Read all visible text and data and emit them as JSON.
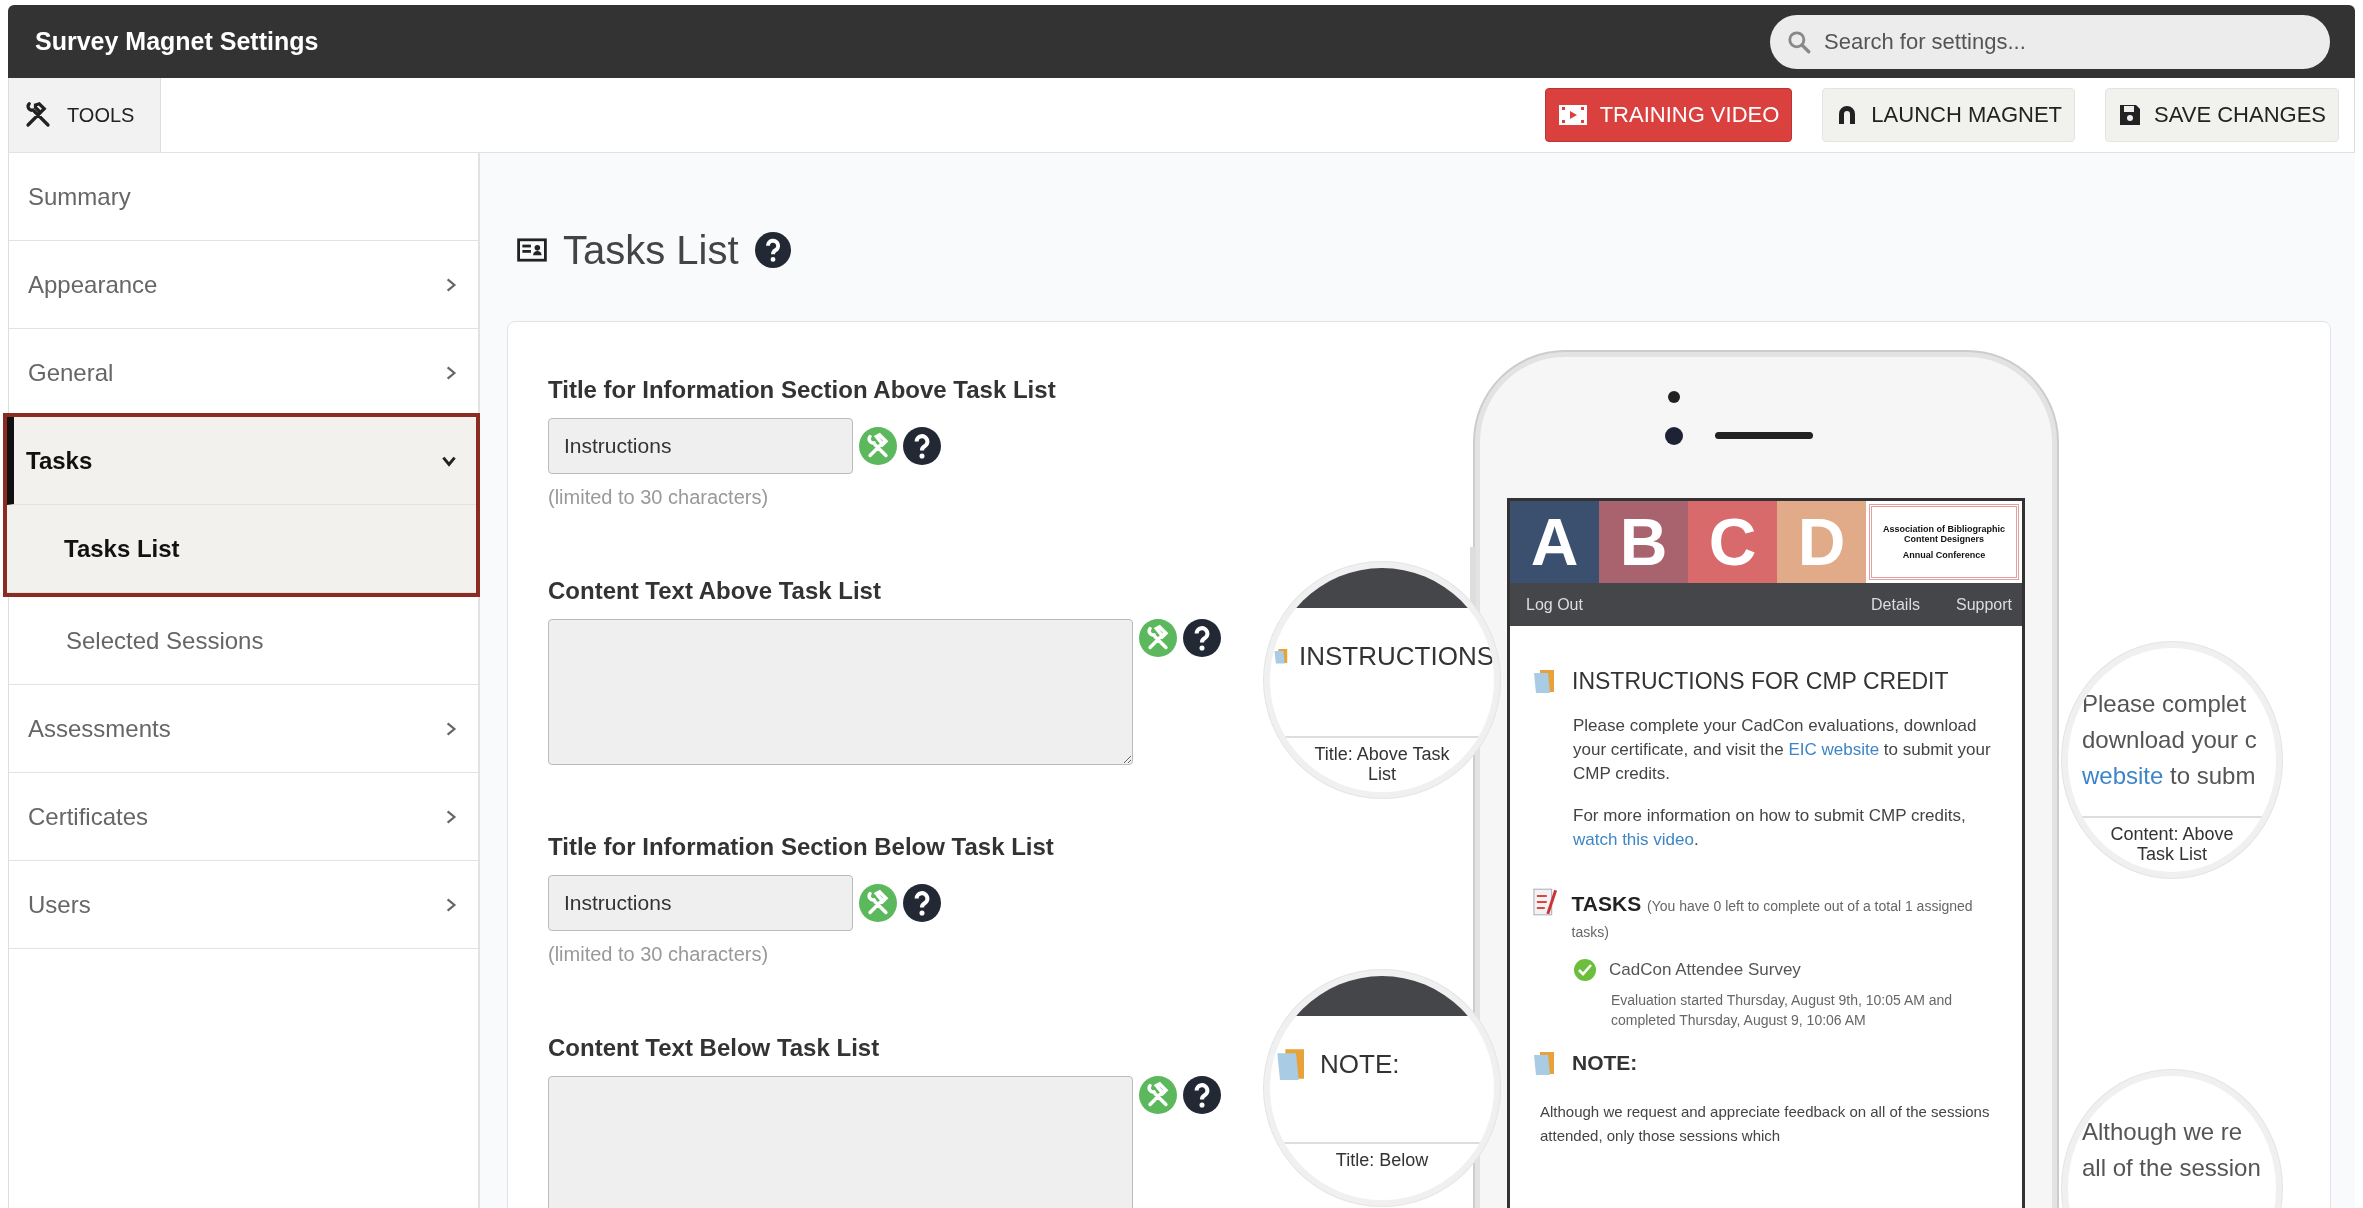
{
  "window": {
    "title": "Survey Magnet Settings"
  },
  "search": {
    "placeholder": "Search for settings..."
  },
  "toolbar": {
    "tools_tab": "TOOLS",
    "buttons": [
      {
        "label": "TRAINING VIDEO",
        "kind": "video"
      },
      {
        "label": "LAUNCH MAGNET",
        "kind": "magnet"
      },
      {
        "label": "SAVE CHANGES",
        "kind": "save"
      }
    ]
  },
  "sidebar": {
    "items": [
      {
        "label": "Summary",
        "kind": "link",
        "selected": false
      },
      {
        "label": "Appearance",
        "kind": "group",
        "selected": false,
        "expanded": false
      },
      {
        "label": "General",
        "kind": "group",
        "selected": false,
        "expanded": false
      },
      {
        "label": "Tasks",
        "kind": "group",
        "selected": true,
        "expanded": true,
        "highlighted": true,
        "children": [
          {
            "label": "Tasks List",
            "selected": true,
            "highlighted": true
          },
          {
            "label": "Selected Sessions",
            "selected": false,
            "highlighted": false
          }
        ]
      },
      {
        "label": "Assessments",
        "kind": "group",
        "selected": false,
        "expanded": false
      },
      {
        "label": "Certificates",
        "kind": "group",
        "selected": false,
        "expanded": false
      },
      {
        "label": "Users",
        "kind": "group",
        "selected": false,
        "expanded": false
      }
    ]
  },
  "page": {
    "title": "Tasks List"
  },
  "fields": [
    {
      "kind": "input",
      "label": "Title for Information Section Above Task List",
      "value": "Instructions",
      "hint": "(limited to 30 characters)"
    },
    {
      "kind": "textarea",
      "label": "Content Text Above Task List"
    },
    {
      "kind": "input",
      "label": "Title for Information Section Below Task List",
      "value": "Instructions",
      "hint": "(limited to 30 characters)"
    },
    {
      "kind": "textarea",
      "label": "Content Text Below Task List"
    }
  ],
  "preview": {
    "header_blocks": [
      {
        "letter": "A",
        "color": "#3b4f6f"
      },
      {
        "letter": "B",
        "color": "#a9636f"
      },
      {
        "letter": "C",
        "color": "#d96a6b"
      },
      {
        "letter": "D",
        "color": "#e1aa88"
      }
    ],
    "logo_lines": [
      "Association of Bibliographic Content Designers",
      "Annual Conference"
    ],
    "nav_left": "Log Out",
    "nav_right": [
      "Details",
      "Support"
    ],
    "instructions": {
      "title": "INSTRUCTIONS FOR CMP CREDIT",
      "paragraphs": [
        [
          {
            "text": "Please complete your CadCon evaluations, download your certificate, and visit the "
          },
          {
            "text": "EIC website",
            "link": true
          },
          {
            "text": " to submit your CMP credits."
          }
        ],
        [
          {
            "text": "For more information on how to submit CMP credits, "
          },
          {
            "text": "watch this video",
            "link": true
          },
          {
            "text": "."
          }
        ]
      ]
    },
    "tasks": {
      "title": "TASKS",
      "note": "(You have 0 left to complete out of a total 1 assigned tasks)",
      "items": [
        {
          "name": "CadCon Attendee Survey",
          "checked": true,
          "detail": "Evaluation started Thursday, August 9th, 10:05 AM and completed Thursday, August 9, 10:06 AM"
        }
      ]
    },
    "note": {
      "title": "NOTE:",
      "text": "Although we request and appreciate feedback on all of the sessions attended, only those sessions which"
    },
    "callouts": [
      {
        "kind": "title",
        "title": "INSTRUCTIONS",
        "caption": "Title: Above Task List"
      },
      {
        "kind": "content",
        "parts": [
          {
            "text": "Please complet"
          },
          {
            "text": "download your c"
          },
          {
            "text": "website",
            "link": true,
            "tail": " to subm"
          }
        ],
        "caption": "Content: Above Task List"
      },
      {
        "kind": "title",
        "title": "NOTE:",
        "caption": "Title: Below"
      },
      {
        "kind": "content",
        "parts": [
          {
            "text": "Although we re"
          },
          {
            "text": "all of the session"
          }
        ]
      }
    ]
  }
}
